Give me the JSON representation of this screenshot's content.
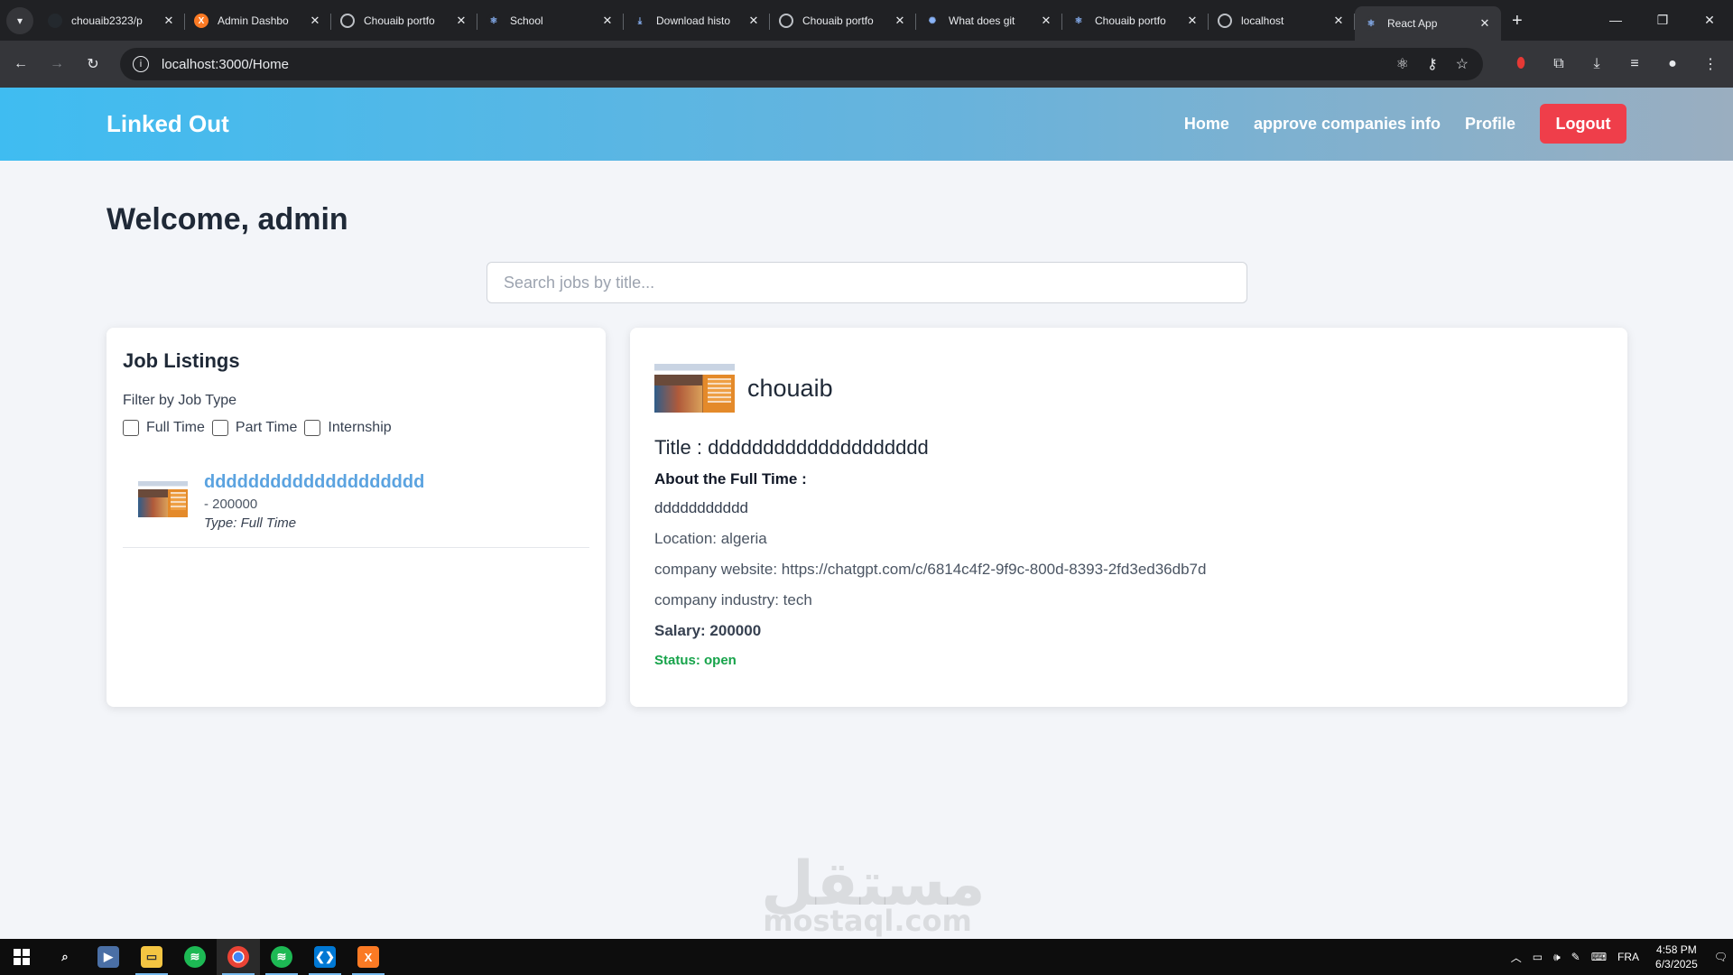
{
  "browser": {
    "tabs": [
      {
        "title": "chouaib2323/p",
        "icon": "github-icon",
        "color": "#24292e",
        "glyph": ""
      },
      {
        "title": "Admin Dashbo",
        "icon": "xampp-icon",
        "color": "#fb7a24",
        "glyph": "X"
      },
      {
        "title": "Chouaib portfo",
        "icon": "globe-icon",
        "color": "#5f6368",
        "glyph": ""
      },
      {
        "title": "School",
        "icon": "react-icon",
        "color": "#202124",
        "glyph": "⚛"
      },
      {
        "title": "Download histo",
        "icon": "download-icon",
        "color": "#202124",
        "glyph": "⤓"
      },
      {
        "title": "Chouaib portfo",
        "icon": "globe-icon",
        "color": "#5f6368",
        "glyph": ""
      },
      {
        "title": "What does git",
        "icon": "chatgpt-icon",
        "color": "#202124",
        "glyph": "✺"
      },
      {
        "title": "Chouaib portfo",
        "icon": "react-icon",
        "color": "#202124",
        "glyph": "⚛"
      },
      {
        "title": "localhost",
        "icon": "globe-icon",
        "color": "#5f6368",
        "glyph": ""
      },
      {
        "title": "React App",
        "icon": "react-icon",
        "color": "#35363a",
        "glyph": "⚛",
        "active": true
      }
    ],
    "url": "localhost:3000/Home"
  },
  "app": {
    "brand": "Linked Out",
    "nav": {
      "home": "Home",
      "approve": "approve companies info",
      "profile": "Profile",
      "logout": "Logout"
    },
    "welcome": "Welcome, admin",
    "search_placeholder": "Search jobs by title...",
    "listings": {
      "heading": "Job Listings",
      "filter_label": "Filter by Job Type",
      "filters": [
        "Full Time",
        "Part Time",
        "Internship"
      ],
      "jobs": [
        {
          "title": "dddddddddddddddddddd",
          "salary": "- 200000",
          "type": "Type: Full Time"
        }
      ]
    },
    "detail": {
      "company": "chouaib",
      "title": "Title : dddddddddddddddddddd",
      "about": "About the Full Time :",
      "description": "ddddddddddd",
      "location": "Location: algeria",
      "website": "company website: https://chatgpt.com/c/6814c4f2-9f9c-800d-8393-2fd3ed36db7d",
      "industry": "company industry: tech",
      "salary": "Salary: 200000",
      "status": "Status: open"
    }
  },
  "watermark": {
    "arabic": "مستقل",
    "latin": "mostaql.com"
  },
  "taskbar": {
    "language": "FRA",
    "time": "4:58 PM",
    "date": "6/3/2025"
  },
  "colors": {
    "accent_red": "#ef3e4a",
    "link_blue": "#5ba3e0",
    "status_green": "#16a34a",
    "nav_gradient_start": "#3fbcf1",
    "nav_gradient_end": "#9aaec0"
  }
}
